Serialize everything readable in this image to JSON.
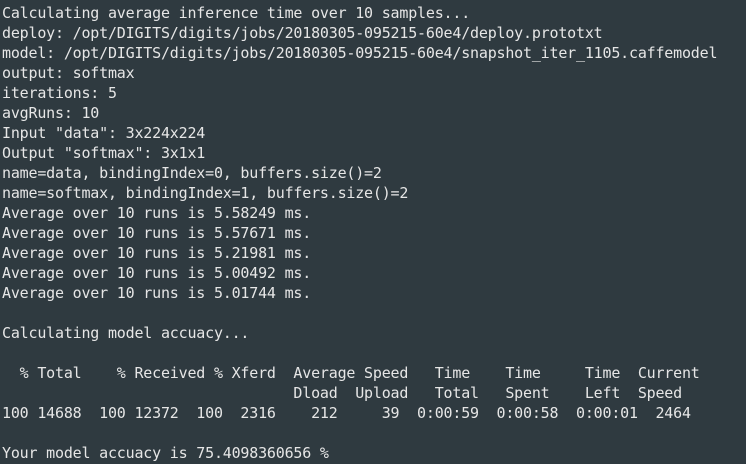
{
  "terminal": {
    "lines": [
      "Calculating average inference time over 10 samples...",
      "deploy: /opt/DIGITS/digits/jobs/20180305-095215-60e4/deploy.prototxt",
      "model: /opt/DIGITS/digits/jobs/20180305-095215-60e4/snapshot_iter_1105.caffemodel",
      "output: softmax",
      "iterations: 5",
      "avgRuns: 10",
      "Input \"data\": 3x224x224",
      "Output \"softmax\": 3x1x1",
      "name=data, bindingIndex=0, buffers.size()=2",
      "name=softmax, bindingIndex=1, buffers.size()=2",
      "Average over 10 runs is 5.58249 ms.",
      "Average over 10 runs is 5.57671 ms.",
      "Average over 10 runs is 5.21981 ms.",
      "Average over 10 runs is 5.00492 ms.",
      "Average over 10 runs is 5.01744 ms.",
      "",
      "Calculating model accuacy...",
      "",
      "  % Total    % Received % Xferd  Average Speed   Time    Time     Time  Current",
      "                                 Dload  Upload   Total   Spent    Left  Speed",
      "100 14688  100 12372  100  2316    212     39  0:00:59  0:00:58  0:00:01  2464",
      "",
      "Your model accuacy is 75.4098360656 %"
    ]
  }
}
